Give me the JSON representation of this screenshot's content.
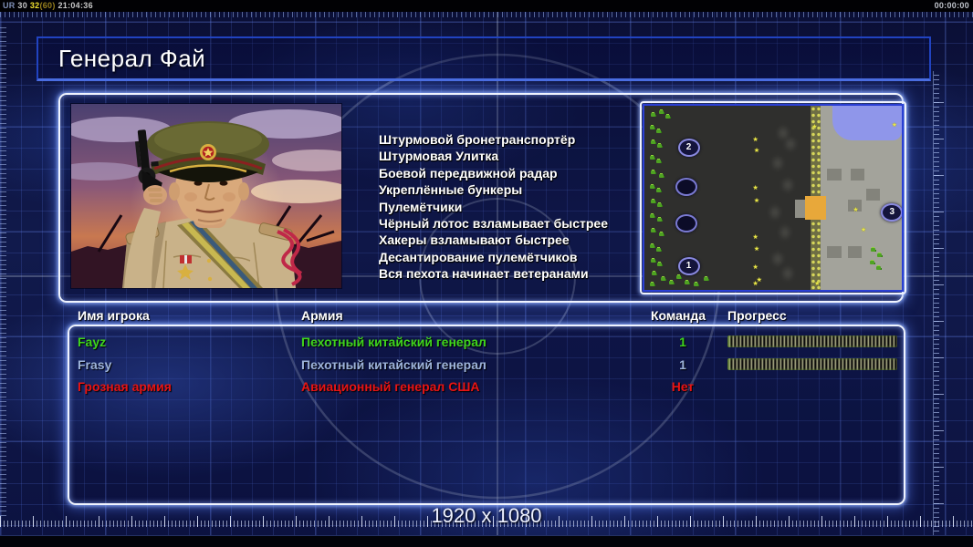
{
  "statusbar": {
    "left_segments": [
      {
        "text": "UR ",
        "color": "#8090b8"
      },
      {
        "text": "30 ",
        "color": "#c8c8c8"
      },
      {
        "text": "32",
        "color": "#f0e030"
      },
      {
        "text": "(60) ",
        "color": "#98801e"
      },
      {
        "text": "21:04:36",
        "color": "#c8c8c8"
      }
    ],
    "timer": "00:00:00"
  },
  "header": {
    "title": "Генерал Фай"
  },
  "loadscreen": {
    "abilities": [
      "Штурмовой бронетранспортёр",
      "Штурмовая Улитка",
      "Боевой передвижной радар",
      "Укреплённые бункеры",
      "Пулемётчики",
      "Чёрный лотос взламывает быстрее",
      "Хакеры взламывают быстрее",
      "Десантирование пулемётчиков",
      "Вся пехота начинает ветеранами"
    ]
  },
  "minimap": {
    "markers": [
      {
        "label": "2",
        "x": 16.5,
        "y": 22,
        "filled": true
      },
      {
        "label": "",
        "x": 15.5,
        "y": 43,
        "filled": false
      },
      {
        "label": "",
        "x": 15.5,
        "y": 63,
        "filled": false
      },
      {
        "label": "1",
        "x": 16.5,
        "y": 86,
        "filled": true
      },
      {
        "label": "3",
        "x": 95.5,
        "y": 57,
        "filled": true
      }
    ],
    "units": [
      [
        2.5,
        4
      ],
      [
        5.5,
        2.5
      ],
      [
        8,
        5
      ],
      [
        2,
        11
      ],
      [
        4.5,
        13
      ],
      [
        2.5,
        19
      ],
      [
        5,
        21
      ],
      [
        2,
        27
      ],
      [
        4.5,
        29
      ],
      [
        2.5,
        35
      ],
      [
        5.5,
        37
      ],
      [
        2,
        43
      ],
      [
        4.5,
        45
      ],
      [
        2.5,
        51
      ],
      [
        5,
        53
      ],
      [
        2,
        59
      ],
      [
        5,
        61
      ],
      [
        2.5,
        67
      ],
      [
        5.5,
        69
      ],
      [
        2,
        75
      ],
      [
        4.5,
        77
      ],
      [
        2.5,
        83
      ],
      [
        5,
        85
      ],
      [
        3,
        90
      ],
      [
        6.5,
        93
      ],
      [
        9.5,
        95
      ],
      [
        12.5,
        92
      ],
      [
        15.5,
        95
      ],
      [
        2,
        96
      ],
      [
        19,
        96
      ],
      [
        23,
        93
      ],
      [
        88,
        77
      ],
      [
        90.5,
        80
      ],
      [
        87.5,
        84
      ],
      [
        90,
        87
      ]
    ],
    "stars": [
      [
        42,
        17
      ],
      [
        42.5,
        23
      ],
      [
        42,
        43
      ],
      [
        42.5,
        50
      ],
      [
        42,
        70
      ],
      [
        42.5,
        76
      ],
      [
        42,
        86
      ],
      [
        43.5,
        93
      ],
      [
        65,
        10
      ],
      [
        66,
        95
      ],
      [
        81,
        55
      ],
      [
        84,
        66
      ],
      [
        42,
        95
      ],
      [
        96,
        9
      ]
    ],
    "blocks": [
      [
        71,
        34
      ],
      [
        80,
        34
      ],
      [
        86,
        45
      ],
      [
        79,
        51
      ],
      [
        71,
        76
      ],
      [
        79,
        76
      ]
    ],
    "smudges": [
      [
        52,
        12
      ],
      [
        55,
        18
      ],
      [
        50,
        28
      ],
      [
        54,
        40
      ],
      [
        49,
        55
      ],
      [
        53,
        66
      ],
      [
        50,
        80
      ],
      [
        54,
        88
      ]
    ]
  },
  "table": {
    "headers": [
      "Имя игрока",
      "Армия",
      "Команда",
      "Прогресс"
    ],
    "rows": [
      {
        "name": "Fayz",
        "army": "Пехотный китайский генерал",
        "team": "1",
        "progress": 100,
        "color": "#3fd41c"
      },
      {
        "name": "Frasy",
        "army": "Пехотный китайский генерал",
        "team": "1",
        "progress": 100,
        "color": "#9db3da"
      },
      {
        "name": "Грозная армия",
        "army": "Авиационный генерал США",
        "team": "Нет",
        "progress": null,
        "color": "#e81414"
      }
    ]
  },
  "footer": {
    "resolution": "1920 x 1080"
  },
  "colors": {
    "accent_blue": "#2a4ad0",
    "frame_glow": "#e9efff",
    "title_border": "#2143c0",
    "minimap_border": "#2a3fd4",
    "progress_light": "#9a9a78",
    "progress_dark": "#0c0c0a"
  }
}
